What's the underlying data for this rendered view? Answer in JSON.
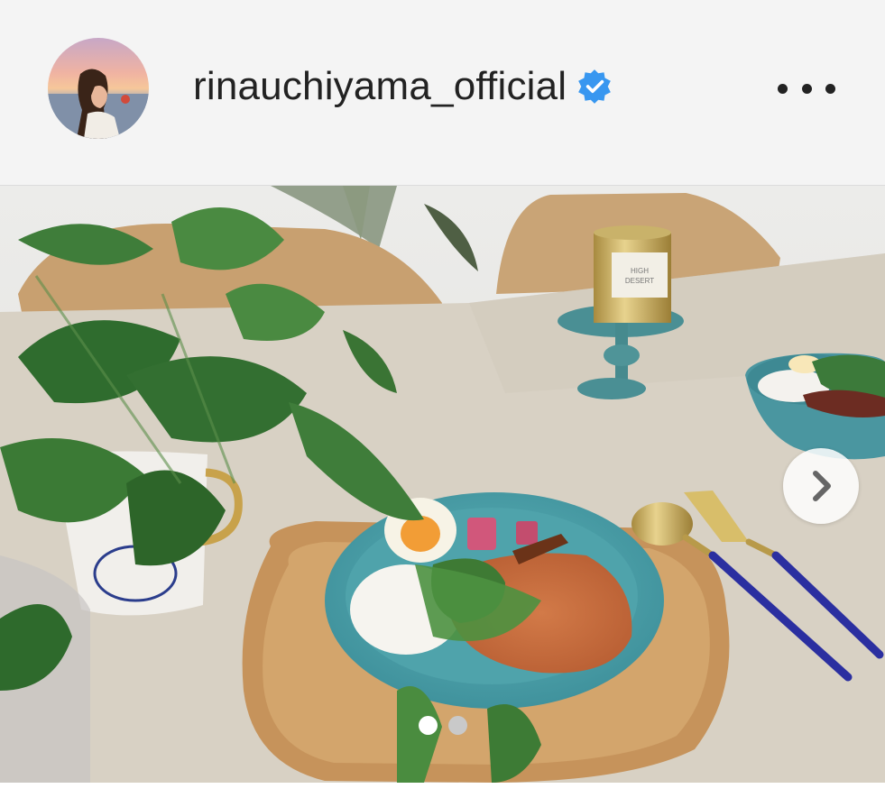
{
  "post": {
    "username": "rinauchiyama_official",
    "verified": true,
    "verified_icon": "verified-badge-icon",
    "more_icon": "more-options-icon"
  },
  "carousel": {
    "slide_count": 2,
    "active_index": 0,
    "next_icon": "chevron-right-icon"
  },
  "colors": {
    "verified_blue": "#3897f0",
    "active_dot": "#ffffff",
    "inactive_dot": "#c9c9c9",
    "header_bg": "#f4f4f4"
  },
  "candle": {
    "line1": "HIGH",
    "line2": "DESERT"
  }
}
